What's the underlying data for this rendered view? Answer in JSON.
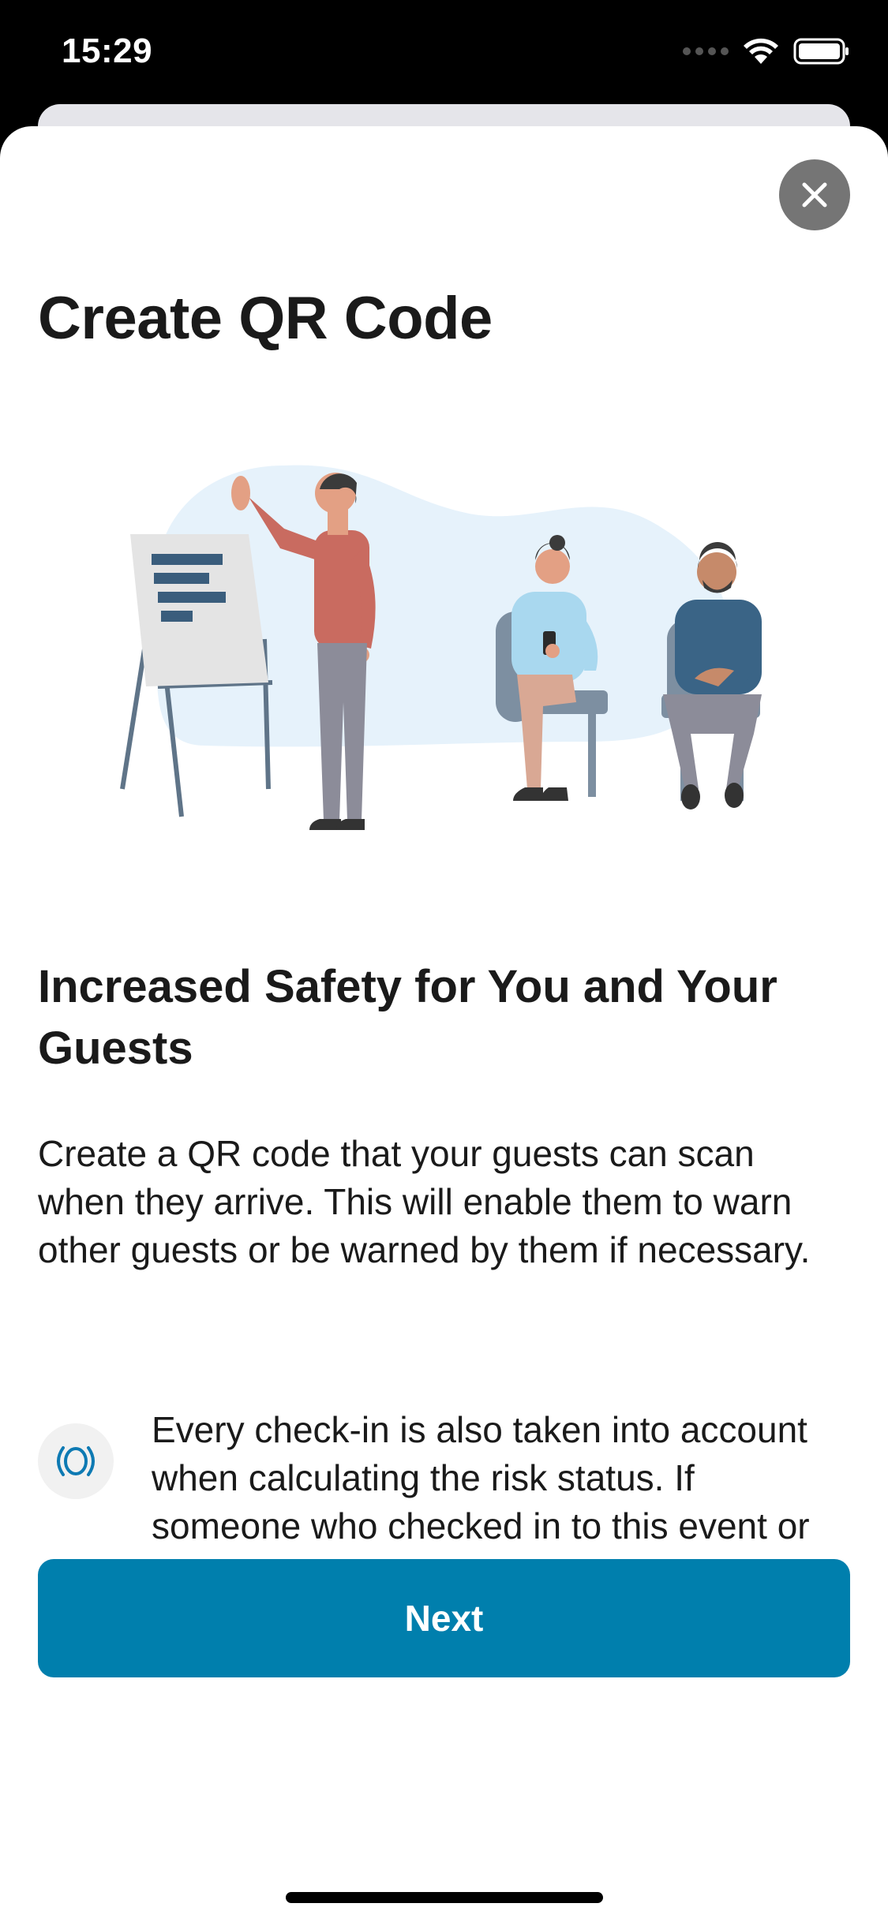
{
  "status_bar": {
    "time": "15:29"
  },
  "sheet": {
    "title": "Create QR Code",
    "subtitle": "Increased Safety for You and Your Guests",
    "body": "Create a QR code that your guests can scan when they arrive. This will enable them to warn other guests or be warned by them if necessary.",
    "info_text": "Every check-in is also taken into account when calculating the risk status. If someone who checked in to this event or place is diagnosed with coronavirus later, the guests can be",
    "next_label": "Next"
  },
  "icons": {
    "close": "close-icon",
    "info": "risk-status-icon",
    "wifi": "wifi-icon",
    "battery": "battery-icon",
    "signal": "cellular-signal-icon"
  },
  "colors": {
    "accent": "#007fad",
    "close_button": "#757575",
    "info_icon": "#0e7ab3",
    "text": "#1a1a1a",
    "illustration_blob": "#e6f2fb"
  }
}
